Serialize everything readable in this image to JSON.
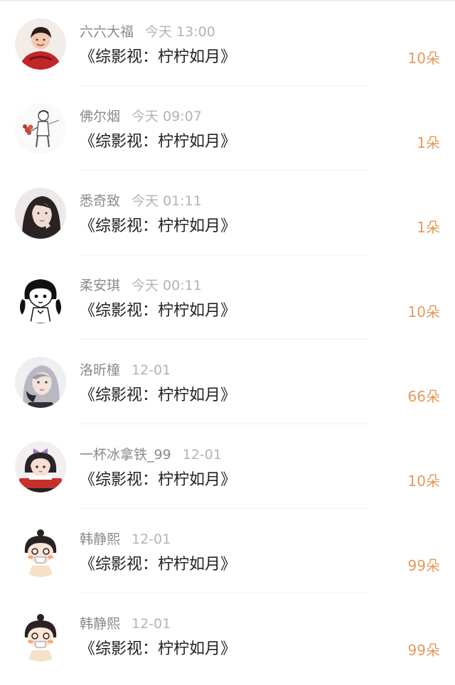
{
  "gift_color": "#e39a5b",
  "rows": [
    {
      "name": "六六大福",
      "time": "今天 13:00",
      "title": "《综影视：柠柠如月》",
      "gift": "10朵",
      "avatar_icon": "avatar-red-dress-icon"
    },
    {
      "name": "佛尔烟",
      "time": "今天 09:07",
      "title": "《综影视：柠柠如月》",
      "gift": "1朵",
      "avatar_icon": "avatar-sketch-boy-flowers-icon"
    },
    {
      "name": "悉奇致",
      "time": "今天 01:11",
      "title": "《综影视：柠柠如月》",
      "gift": "1朵",
      "avatar_icon": "avatar-dark-hair-girl-icon"
    },
    {
      "name": "柔安琪",
      "time": "今天 00:11",
      "title": "《综影视：柠柠如月》",
      "gift": "10朵",
      "avatar_icon": "avatar-pigtail-cartoon-icon"
    },
    {
      "name": "洛昕橦",
      "time": "12-01",
      "title": "《综影视：柠柠如月》",
      "gift": "66朵",
      "avatar_icon": "avatar-silver-hair-girl-icon"
    },
    {
      "name": "一杯冰拿铁_99",
      "time": "12-01",
      "title": "《综影视：柠柠如月》",
      "gift": "10朵",
      "avatar_icon": "avatar-bow-girl-cartoon-icon"
    },
    {
      "name": "韩静熙",
      "time": "12-01",
      "title": "《综影视：柠柠如月》",
      "gift": "99朵",
      "avatar_icon": "avatar-bun-girl-mask-icon"
    },
    {
      "name": "韩静熙",
      "time": "12-01",
      "title": "《综影视：柠柠如月》",
      "gift": "99朵",
      "avatar_icon": "avatar-bun-girl-mask-icon"
    }
  ]
}
